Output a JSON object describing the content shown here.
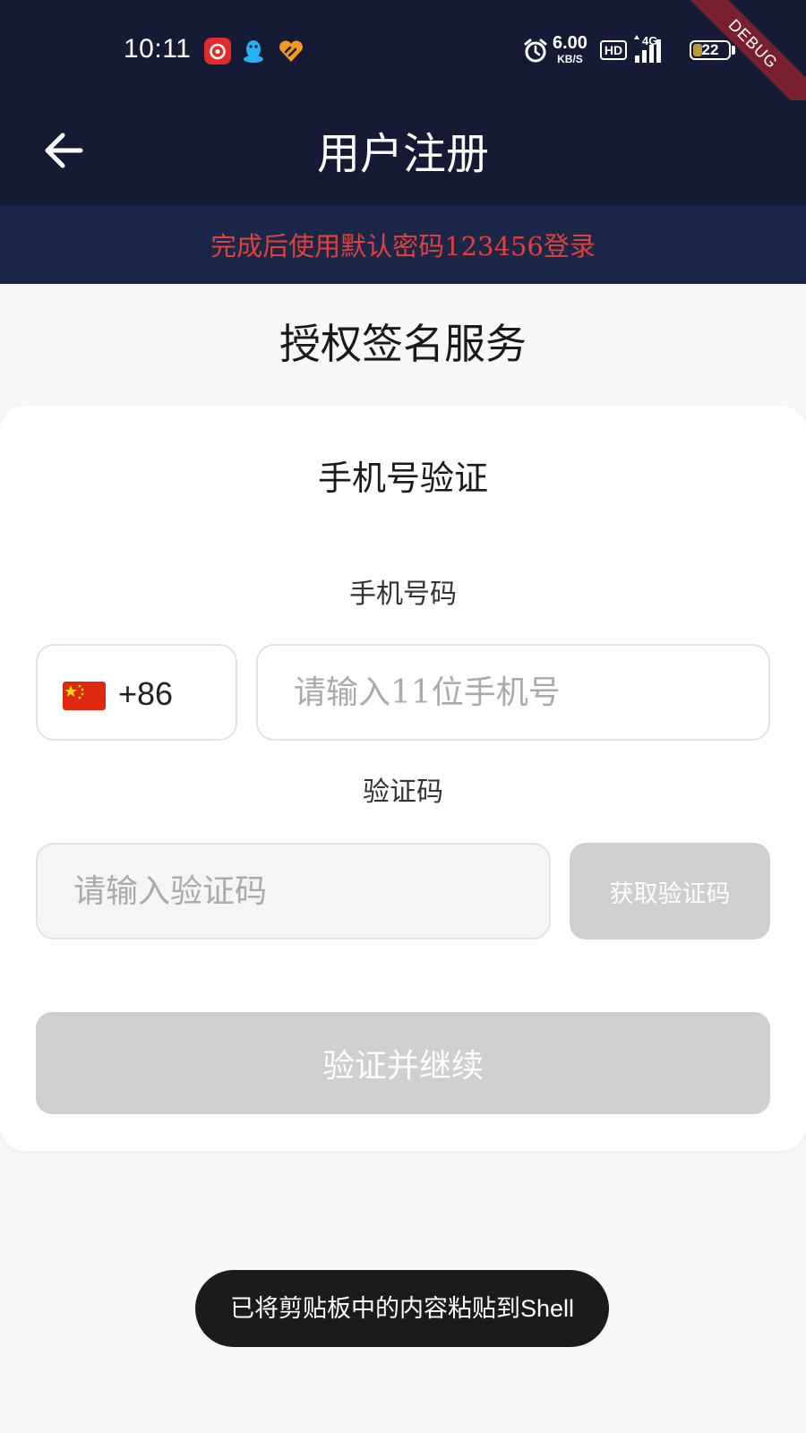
{
  "status_bar": {
    "time": "10:11",
    "notification_icons": [
      "netease-music-icon",
      "qq-icon",
      "app-heart-icon"
    ],
    "net_speed_value": "6.00",
    "net_speed_unit": "KB/S",
    "hd_label": "HD",
    "network_label": "4G",
    "battery_level": "22",
    "debug_label": "DEBUG"
  },
  "app_bar": {
    "title": "用户注册",
    "back_icon": "arrow-left-icon"
  },
  "banner": {
    "text": "完成后使用默认密码123456登录"
  },
  "page_heading": "授权签名服务",
  "form": {
    "title": "手机号验证",
    "phone_label": "手机号码",
    "country_code": "+86",
    "phone_placeholder": "请输入11位手机号",
    "code_label": "验证码",
    "code_placeholder": "请输入验证码",
    "get_code_label": "获取验证码",
    "submit_label": "验证并继续"
  },
  "toast": {
    "text": "已将剪贴板中的内容粘贴到Shell"
  },
  "colors": {
    "header_bg": "#151b34",
    "banner_bg": "#1c2648",
    "banner_text": "#e0413c",
    "disabled_button": "#cfcfd1"
  }
}
